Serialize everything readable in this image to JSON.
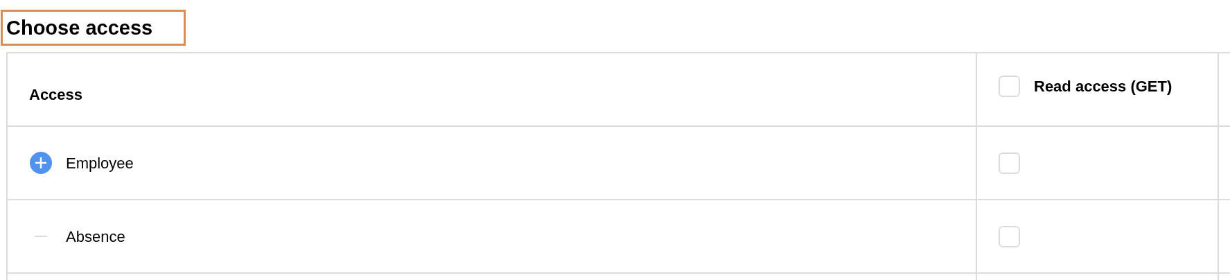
{
  "heading": {
    "text": "Choose access",
    "outlined": true
  },
  "table": {
    "columns": [
      {
        "label": "Access"
      },
      {
        "label": "Read access (GET)",
        "checked": false
      }
    ],
    "rows": [
      {
        "kind": "expandable",
        "label": "Employee",
        "checked": false
      },
      {
        "kind": "leaf",
        "label": "Absence",
        "checked": false
      }
    ]
  }
}
